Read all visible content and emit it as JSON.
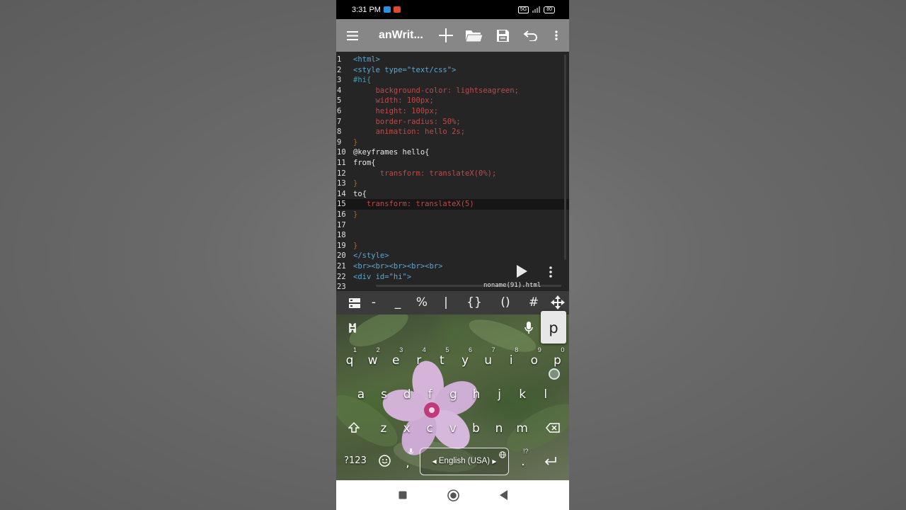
{
  "status": {
    "time": "3:31 PM",
    "network_badge": "5G",
    "battery": "80"
  },
  "toolbar": {
    "title": "anWrit...",
    "icons": [
      "menu-icon",
      "add-icon",
      "folder-open-icon",
      "save-icon",
      "undo-icon",
      "more-vert-icon"
    ]
  },
  "editor": {
    "file_name": "noname(91).html",
    "lines": [
      {
        "n": "1",
        "t": "<html>"
      },
      {
        "n": "2",
        "t": "<style type=\"text/css\">"
      },
      {
        "n": "3",
        "t": "#hi{"
      },
      {
        "n": "4",
        "t": "     background-color: lightseagreen;"
      },
      {
        "n": "5",
        "t": "     width: 100px;"
      },
      {
        "n": "6",
        "t": "     height: 100px;"
      },
      {
        "n": "7",
        "t": "     border-radius: 50%;"
      },
      {
        "n": "8",
        "t": "     animation: hello 2s;"
      },
      {
        "n": "9",
        "t": "}"
      },
      {
        "n": "10",
        "t": "@keyframes hello{"
      },
      {
        "n": "11",
        "t": "from{"
      },
      {
        "n": "12",
        "t": "      transform: translateX(0%);"
      },
      {
        "n": "13",
        "t": "}"
      },
      {
        "n": "14",
        "t": "to{"
      },
      {
        "n": "15",
        "t": "   transform: translateX(5)"
      },
      {
        "n": "16",
        "t": "}"
      },
      {
        "n": "17",
        "t": ""
      },
      {
        "n": "18",
        "t": ""
      },
      {
        "n": "19",
        "t": "}"
      },
      {
        "n": "20",
        "t": "</style>"
      },
      {
        "n": "21",
        "t": "<br><br><br><br><br>"
      },
      {
        "n": "22",
        "t": "<div id=\"hi\">"
      },
      {
        "n": "23",
        "t": ""
      }
    ]
  },
  "symbols": [
    "-",
    "_",
    "%",
    "|",
    "{}",
    "()",
    "#"
  ],
  "keyboard": {
    "popup_key": "p",
    "row1": [
      "q",
      "w",
      "e",
      "r",
      "t",
      "y",
      "u",
      "i",
      "o",
      "p"
    ],
    "row1_hints": [
      "1",
      "2",
      "3",
      "4",
      "5",
      "6",
      "7",
      "8",
      "9",
      "0"
    ],
    "row2": [
      "a",
      "s",
      "d",
      "f",
      "g",
      "h",
      "j",
      "k",
      "l"
    ],
    "row3": [
      "z",
      "x",
      "c",
      "v",
      "b",
      "n",
      "m"
    ],
    "symbols_key": "?123",
    "comma_key": ",",
    "space_label": "English (USA)",
    "period_key": ".",
    "period_hint": "!?"
  },
  "colors": {
    "toolbar": "#878787",
    "editor_bg": "#252525",
    "tag": "#5aa7d6",
    "property": "#c24848",
    "punctuation": "#a8682e"
  }
}
